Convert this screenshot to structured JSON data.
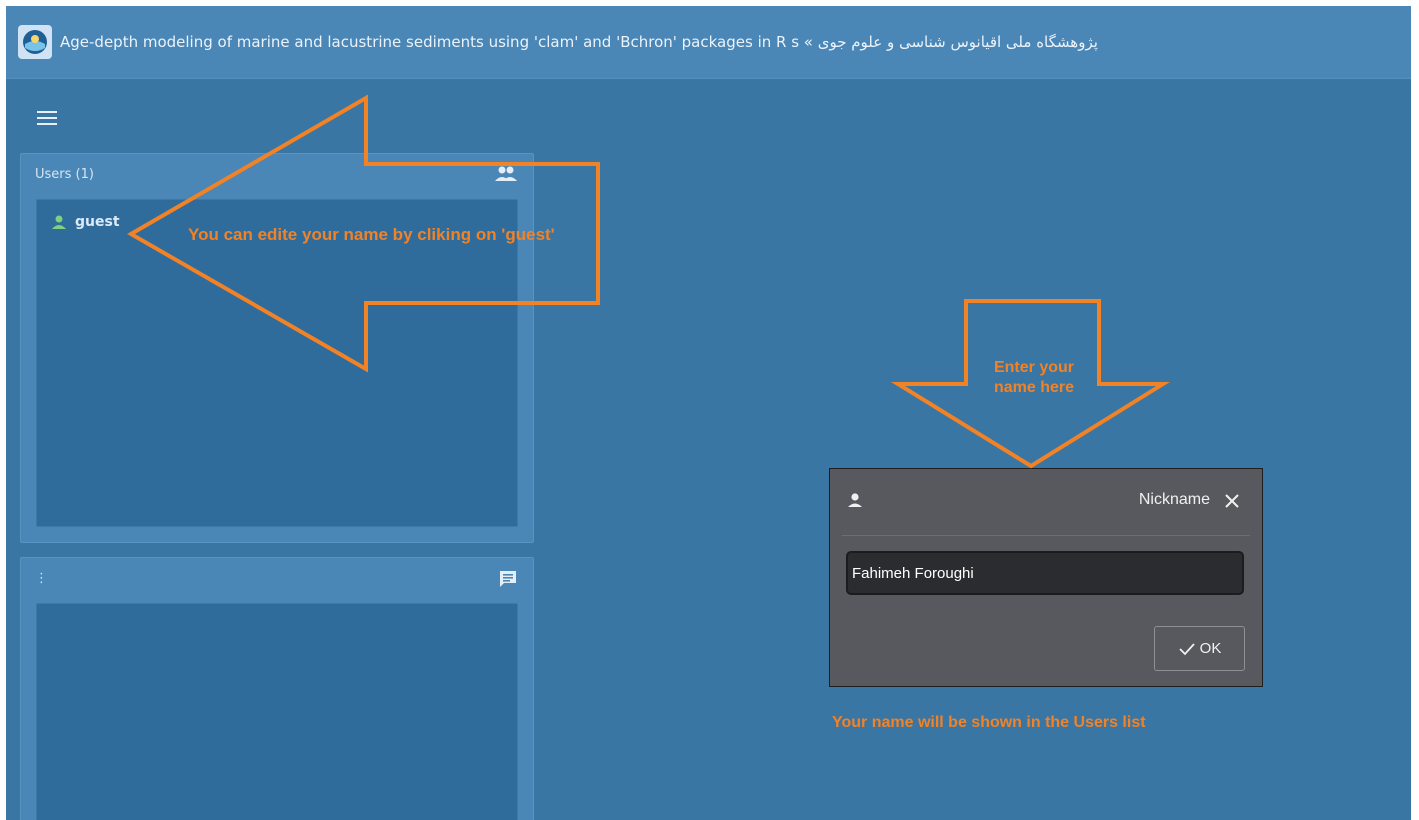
{
  "window": {
    "title": "پژوهشگاه ملی اقیانوس شناسی و علوم جوی » Age-depth modeling of marine and lacustrine sediments using 'clam' and 'Bchron' packages in R s",
    "logo_icon": "institute-logo-icon"
  },
  "sidebar": {
    "menu_icon": "hamburger-menu-icon",
    "users_panel": {
      "title": "Users (1)",
      "icon": "users-group-icon",
      "users": [
        {
          "name": "guest",
          "icon": "user-icon",
          "color": "#7fd07f"
        }
      ]
    },
    "chat_panel": {
      "title": "⋮",
      "icon": "chat-icon"
    }
  },
  "dialog": {
    "icon": "user-icon",
    "title": "Nickname",
    "close_icon": "close-icon",
    "input_value": "Fahimeh Foroughi",
    "ok_label": "OK",
    "ok_icon": "checkmark-icon"
  },
  "annotations": {
    "guest_hint": "You can edite your name by cliking on 'guest'",
    "enter_hint": "Enter your name here",
    "users_list_hint": "Your name will be shown in the Users list",
    "color": "#f28226"
  },
  "colors": {
    "background": "#3a76a4",
    "topbar": "#4a86b6",
    "panel": "#4a86b6",
    "panel_inner": "#2f6c9b",
    "dialog": "#58595e"
  }
}
